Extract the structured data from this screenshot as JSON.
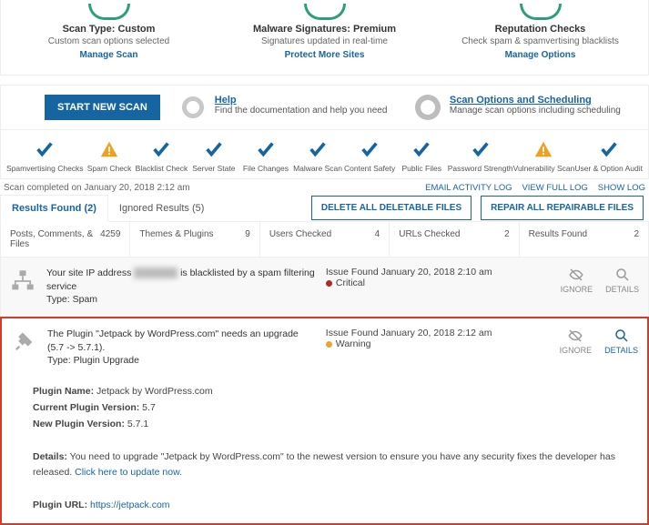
{
  "header_cards": [
    {
      "title": "Scan Type: Custom",
      "sub": "Custom scan options selected",
      "link": "Manage Scan"
    },
    {
      "title": "Malware Signatures: Premium",
      "sub": "Signatures updated in real-time",
      "link": "Protect More Sites"
    },
    {
      "title": "Reputation Checks",
      "sub": "Check spam & spamvertising blacklists",
      "link": "Manage Options"
    }
  ],
  "start_btn": "START NEW SCAN",
  "help": {
    "title": "Help",
    "sub": "Find the documentation and help you need"
  },
  "sched": {
    "title": "Scan Options and Scheduling",
    "sub": "Manage scan options including scheduling"
  },
  "checks": [
    {
      "label": "Spamvertising Checks",
      "state": "ok"
    },
    {
      "label": "Spam Check",
      "state": "warn"
    },
    {
      "label": "Blacklist Check",
      "state": "ok"
    },
    {
      "label": "Server State",
      "state": "ok"
    },
    {
      "label": "File Changes",
      "state": "ok"
    },
    {
      "label": "Malware Scan",
      "state": "ok"
    },
    {
      "label": "Content Safety",
      "state": "ok"
    },
    {
      "label": "Public Files",
      "state": "ok"
    },
    {
      "label": "Password Strength",
      "state": "ok"
    },
    {
      "label": "Vulnerability Scan",
      "state": "warn"
    },
    {
      "label": "User & Option Audit",
      "state": "ok"
    }
  ],
  "scan_completed": "Scan completed on January 20, 2018 2:12 am",
  "top_links": {
    "email": "EMAIL ACTIVITY LOG",
    "full": "VIEW FULL LOG",
    "show": "SHOW LOG"
  },
  "tabs": {
    "results": "Results Found (2)",
    "ignored": "Ignored Results (5)"
  },
  "tab_buttons": {
    "delete": "DELETE ALL DELETABLE FILES",
    "repair": "REPAIR ALL REPAIRABLE FILES"
  },
  "stats": [
    {
      "k": "Posts, Comments, & Files",
      "v": "4259"
    },
    {
      "k": "Themes & Plugins",
      "v": "9"
    },
    {
      "k": "Users Checked",
      "v": "4"
    },
    {
      "k": "URLs Checked",
      "v": "2"
    },
    {
      "k": "Results Found",
      "v": "2"
    }
  ],
  "issue1": {
    "line1a": "Your site IP address ",
    "line1b": " is blacklisted by a spam filtering service",
    "type": "Type: Spam",
    "found": "Issue Found January 20, 2018 2:10 am",
    "sev": "Critical"
  },
  "issue2": {
    "line": "The Plugin \"Jetpack by WordPress.com\" needs an upgrade (5.7 -> 5.7.1).",
    "type": "Type: Plugin Upgrade",
    "found": "Issue Found January 20, 2018 2:12 am",
    "sev": "Warning"
  },
  "actions": {
    "ignore": "IGNORE",
    "details": "DETAILS"
  },
  "details": {
    "name_k": "Plugin Name:",
    "name_v": " Jetpack by WordPress.com",
    "cur_k": "Current Plugin Version:",
    "cur_v": " 5.7",
    "new_k": "New Plugin Version:",
    "new_v": " 5.7.1",
    "det_k": "Details:",
    "det_v": " You need to upgrade \"Jetpack by WordPress.com\" to the newest version to ensure you have any security fixes the developer has released.",
    "click": "Click here to update now.",
    "url_k": "Plugin URL:",
    "url_v": " https://jetpack.com"
  }
}
